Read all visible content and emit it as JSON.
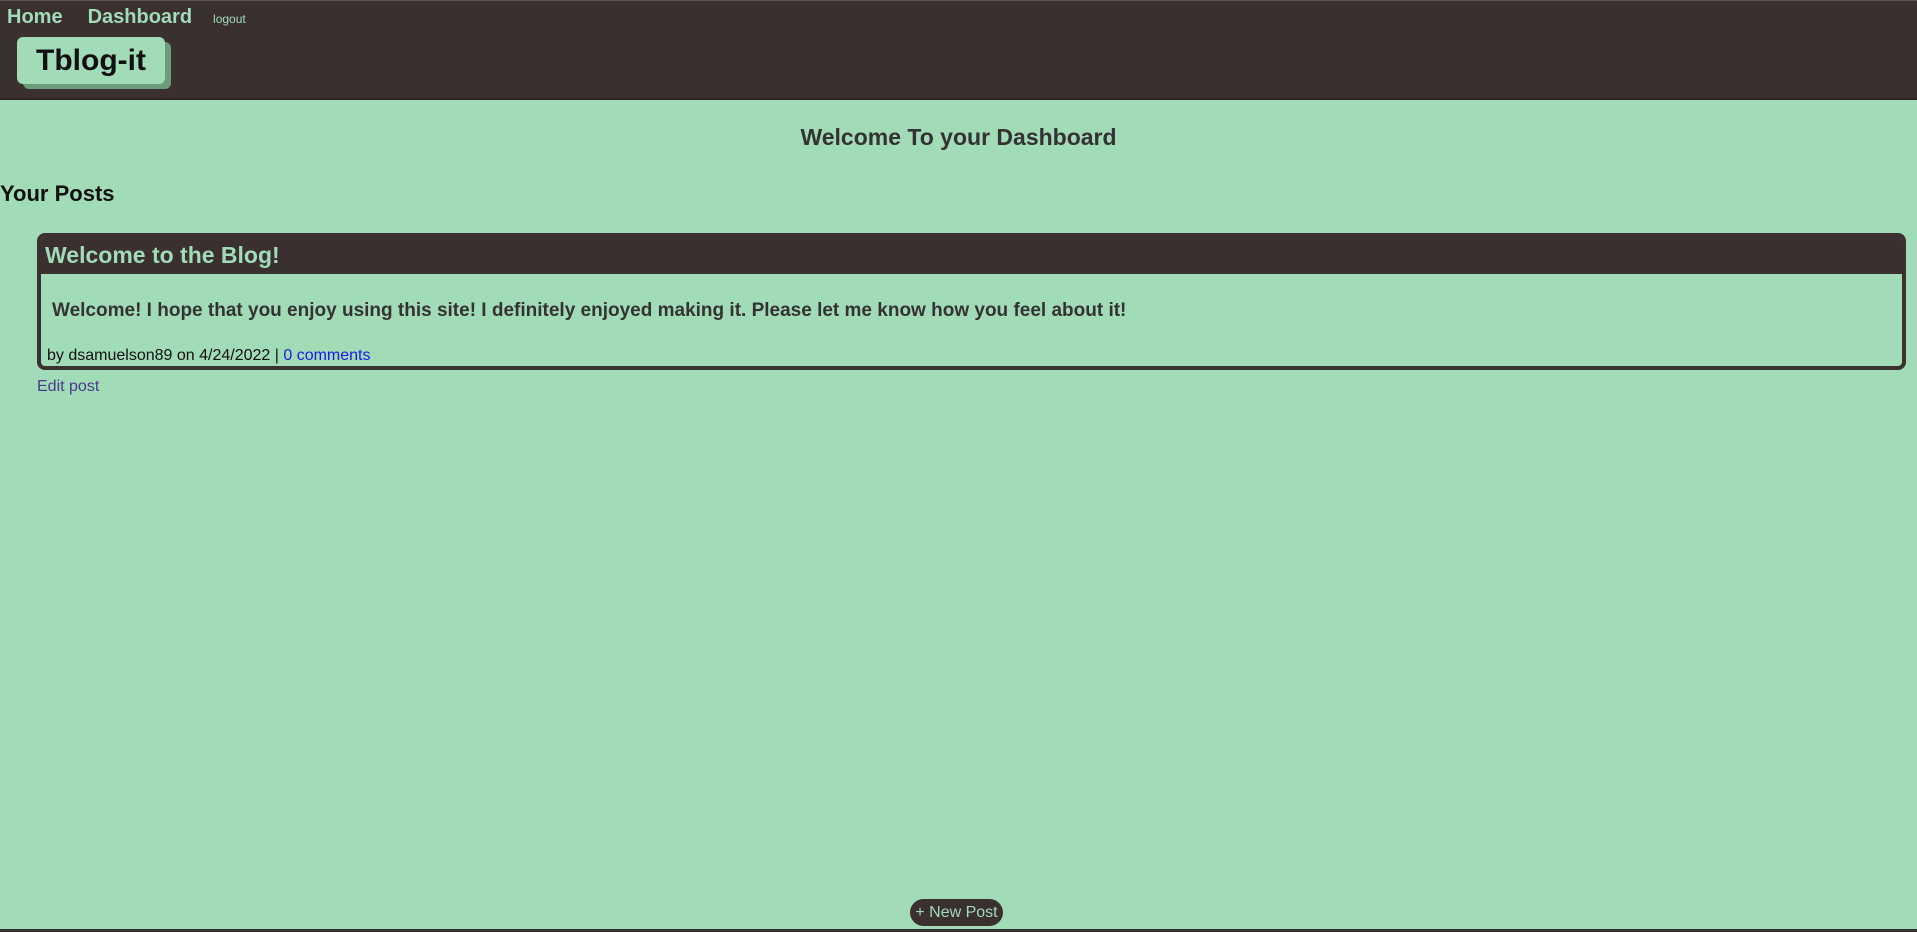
{
  "nav": {
    "home": "Home",
    "dashboard": "Dashboard",
    "logout": "logout"
  },
  "logo": "Tblog-it",
  "dashboard_title": "Welcome To your Dashboard",
  "section_title": "Your Posts",
  "posts": [
    {
      "title": "Welcome to the Blog!",
      "body": "Welcome! I hope that you enjoy using this site! I definitely enjoyed making it. Please let me know how you feel about it!",
      "meta_prefix": "by dsamuelson89 on 4/24/2022 |",
      "comments_link": "0 comments",
      "edit_label": "Edit post"
    }
  ],
  "new_post_button": "+ New Post",
  "colors": {
    "accent_green": "#a2dbb7",
    "dark_brown": "#3a3030",
    "link_blue": "#1a1ae6"
  }
}
